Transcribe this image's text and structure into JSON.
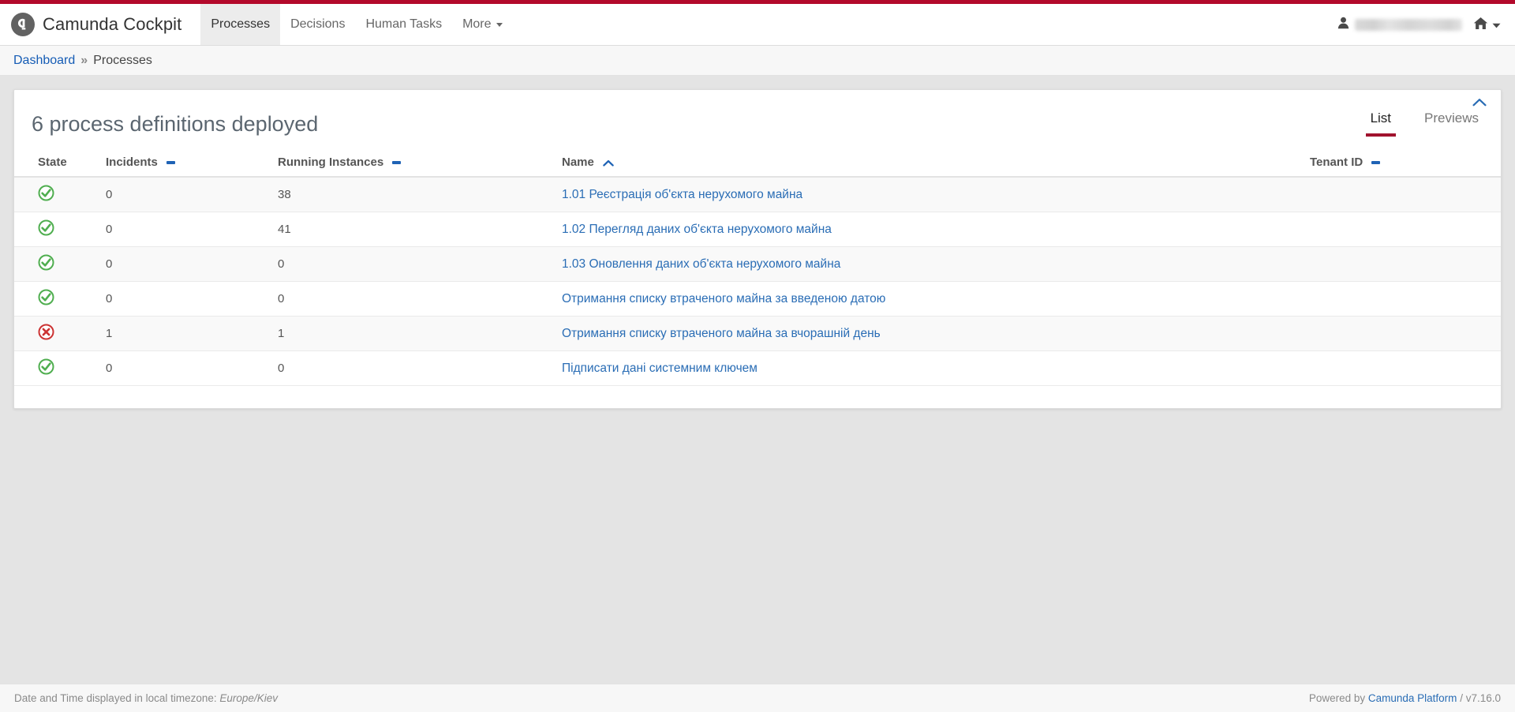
{
  "accent": {
    "brand_red": "#b3092b",
    "tab_underline": "#a1132e",
    "link_blue": "#2a6db5",
    "sort_blue": "#1f63b5",
    "ok_green": "#4fae4f",
    "error_red": "#cc3333"
  },
  "navbar": {
    "logo_icon": "camunda-logo-icon",
    "title": "Camunda Cockpit",
    "items": [
      {
        "label": "Processes",
        "active": true
      },
      {
        "label": "Decisions",
        "active": false
      },
      {
        "label": "Human Tasks",
        "active": false
      },
      {
        "label": "More",
        "active": false,
        "has_caret": true
      }
    ],
    "user_icon": "user-icon",
    "user_name": "",
    "home_icon": "home-icon",
    "home_caret_icon": "caret-down-icon"
  },
  "breadcrumb": {
    "root": "Dashboard",
    "separator": "»",
    "current": "Processes"
  },
  "panel": {
    "title": "6 process definitions deployed",
    "collapse_icon": "chevron-up-icon",
    "tabs": [
      {
        "label": "List",
        "active": true
      },
      {
        "label": "Previews",
        "active": false
      }
    ]
  },
  "table": {
    "columns": [
      {
        "label": "State",
        "sort": "none"
      },
      {
        "label": "Incidents",
        "sort": "unsorted"
      },
      {
        "label": "Running Instances",
        "sort": "unsorted"
      },
      {
        "label": "Name",
        "sort": "asc"
      },
      {
        "label": "Tenant ID",
        "sort": "unsorted"
      }
    ],
    "rows": [
      {
        "state": "ok",
        "state_icon": "check-circle-icon",
        "incidents": "0",
        "running": "38",
        "name": "1.01 Реєстрація об'єкта нерухомого майна",
        "tenant": ""
      },
      {
        "state": "ok",
        "state_icon": "check-circle-icon",
        "incidents": "0",
        "running": "41",
        "name": "1.02 Перегляд даних об'єкта нерухомого майна",
        "tenant": ""
      },
      {
        "state": "ok",
        "state_icon": "check-circle-icon",
        "incidents": "0",
        "running": "0",
        "name": "1.03 Оновлення даних об'єкта нерухомого майна",
        "tenant": ""
      },
      {
        "state": "ok",
        "state_icon": "check-circle-icon",
        "incidents": "0",
        "running": "0",
        "name": "Отримання списку втраченого майна за введеною датою",
        "tenant": ""
      },
      {
        "state": "error",
        "state_icon": "error-circle-icon",
        "incidents": "1",
        "running": "1",
        "name": "Отримання списку втраченого майна за вчорашній день",
        "tenant": ""
      },
      {
        "state": "ok",
        "state_icon": "check-circle-icon",
        "incidents": "0",
        "running": "0",
        "name": "Підписати дані системним ключем",
        "tenant": ""
      }
    ]
  },
  "footer": {
    "timezone_prefix": "Date and Time displayed in local timezone:",
    "timezone": "Europe/Kiev",
    "powered_prefix": "Powered by",
    "powered_link": "Camunda Platform",
    "version": "/ v7.16.0"
  }
}
